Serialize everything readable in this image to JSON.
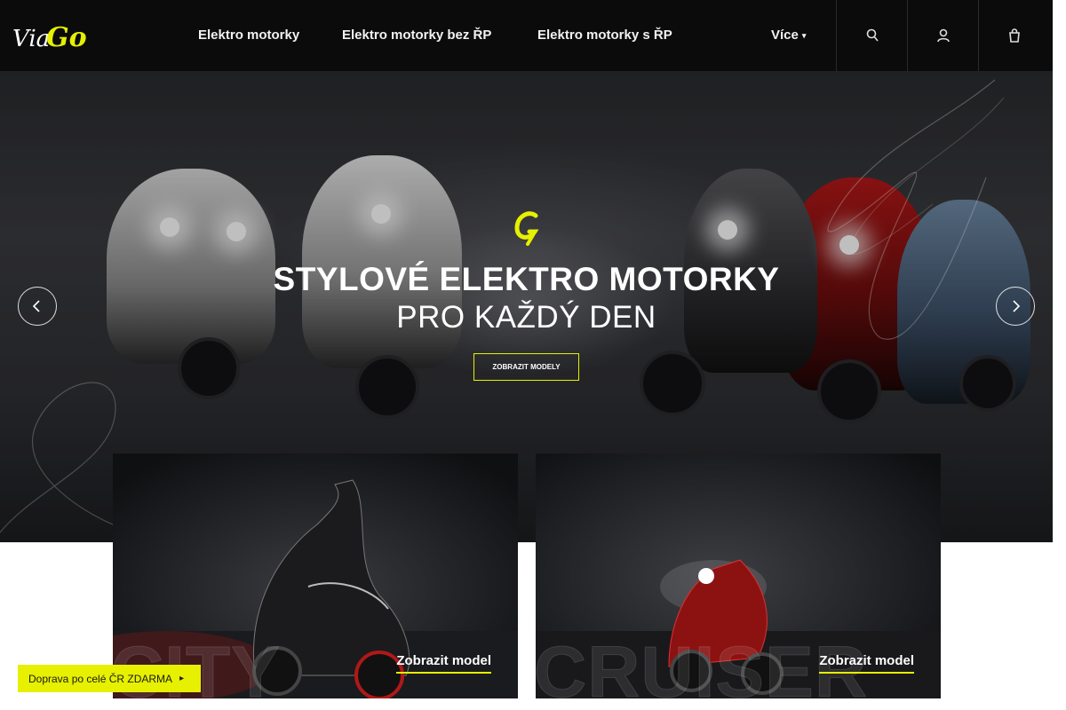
{
  "header": {
    "logo_text": "ViaGo",
    "nav": [
      {
        "label": "Elektro motorky"
      },
      {
        "label": "Elektro motorky bez ŘP"
      },
      {
        "label": "Elektro motorky s ŘP"
      }
    ],
    "more_label": "Více",
    "icons": [
      "search-icon",
      "user-icon",
      "cart-icon"
    ]
  },
  "hero": {
    "title": "STYLOVÉ ELEKTRO MOTORKY",
    "subtitle": "PRO KAŽDÝ DEN",
    "cta_label": "ZOBRAZIT MODELY"
  },
  "cards": [
    {
      "name": "CITY",
      "link_label": "Zobrazit model"
    },
    {
      "name": "CRUISER",
      "link_label": "Zobrazit model"
    }
  ],
  "shipping": {
    "label": "Doprava po celé ČR ZDARMA"
  },
  "colors": {
    "accent": "#e6f000",
    "header_bg": "#0b0b0b"
  }
}
